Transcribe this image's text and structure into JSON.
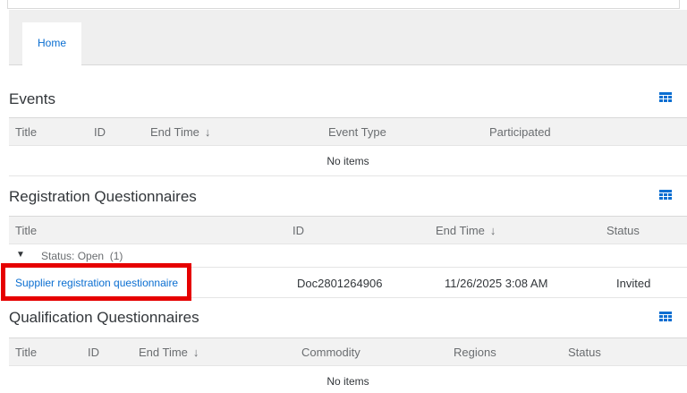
{
  "tabs": [
    {
      "label": "Home"
    }
  ],
  "events": {
    "title": "Events",
    "columns": [
      "Title",
      "ID",
      "End Time",
      "Event Type",
      "Participated"
    ],
    "empty_text": "No items"
  },
  "registration": {
    "title": "Registration Questionnaires",
    "columns": [
      "Title",
      "ID",
      "End Time",
      "Status"
    ],
    "group_label": "Status: Open",
    "group_count": "(1)",
    "rows": [
      {
        "title": "Supplier registration questionnaire",
        "id": "Doc2801264906",
        "end_time": "11/26/2025 3:08 AM",
        "status": "Invited"
      }
    ]
  },
  "qualification": {
    "title": "Qualification Questionnaires",
    "columns": [
      "Title",
      "ID",
      "End Time",
      "Commodity",
      "Regions",
      "Status"
    ],
    "empty_text": "No items"
  },
  "icons": {
    "sort": "arrow-down-icon",
    "table_settings": "table-grid-icon",
    "expand": "triangle-down-icon"
  },
  "colors": {
    "link": "#0a6ed1",
    "highlight": "#e60000",
    "header_bg": "#f2f2f2"
  }
}
